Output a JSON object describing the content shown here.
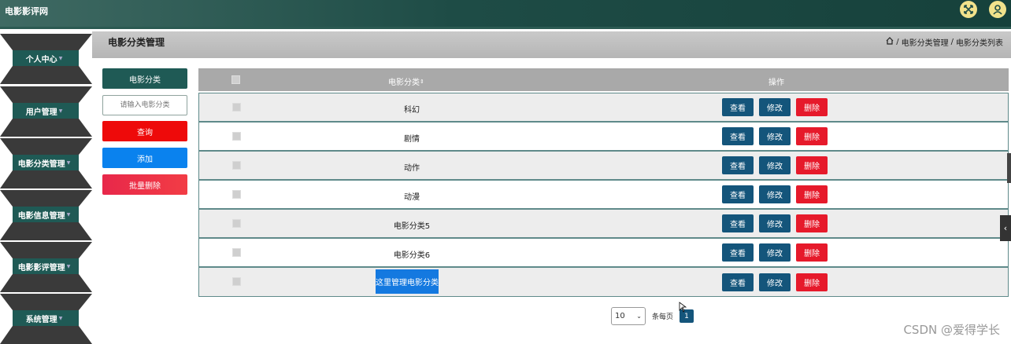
{
  "app": {
    "title": "电影影评网"
  },
  "header_icons": {
    "fullscreen": "fullscreen-icon",
    "user": "user-icon"
  },
  "sidebar": {
    "items": [
      {
        "label": "个人中心"
      },
      {
        "label": "用户管理"
      },
      {
        "label": "电影分类管理"
      },
      {
        "label": "电影信息管理"
      },
      {
        "label": "电影影评管理"
      },
      {
        "label": "系统管理"
      }
    ]
  },
  "page": {
    "title": "电影分类管理",
    "breadcrumb": [
      "电影分类管理",
      "电影分类列表"
    ],
    "breadcrumb_sep": "/"
  },
  "filters": {
    "category_btn": "电影分类",
    "search_placeholder": "请输入电影分类",
    "query_btn": "查询",
    "add_btn": "添加",
    "batch_delete_btn": "批量删除"
  },
  "table": {
    "columns": {
      "name": "电影分类",
      "ops": "操作"
    },
    "rows": [
      {
        "name": "科幻"
      },
      {
        "name": "剧情"
      },
      {
        "name": "动作"
      },
      {
        "name": "动漫"
      },
      {
        "name": "电影分类5"
      },
      {
        "name": "电影分类6"
      },
      {
        "name": "这里管理电影分类"
      }
    ],
    "actions": {
      "view": "查看",
      "edit": "修改",
      "delete": "删除"
    }
  },
  "pagination": {
    "page_size": "10",
    "per_page_label": "条每页",
    "current_page": "1"
  },
  "watermark": "CSDN @爱得学长",
  "colors": {
    "topbar": "#1e4c46",
    "primary": "#14557b",
    "danger": "#e61a2b",
    "query": "#ee0a0a",
    "add": "#0a82ee",
    "batch": "#f02d45"
  }
}
